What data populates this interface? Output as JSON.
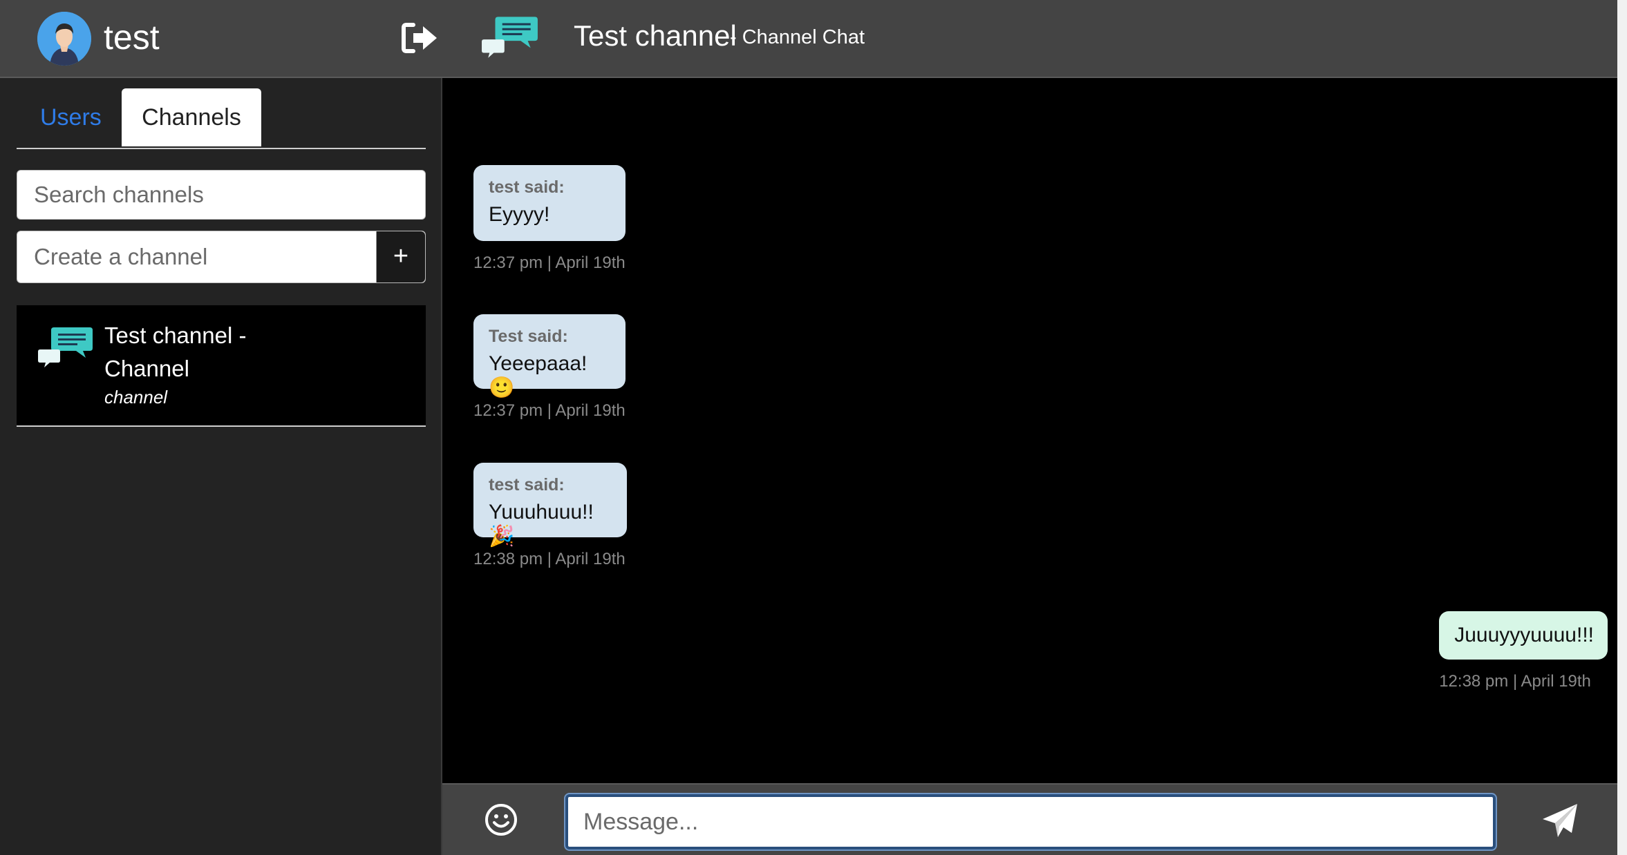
{
  "sidebar": {
    "user": {
      "name": "test"
    },
    "tabs": [
      {
        "label": "Users"
      },
      {
        "label": "Channels"
      }
    ],
    "search": {
      "placeholder": "Search channels"
    },
    "create": {
      "placeholder": "Create a channel",
      "button_label": "+"
    },
    "channels": [
      {
        "name": "Test channel - Channel",
        "type": "channel"
      }
    ]
  },
  "chat": {
    "title": "Test channel",
    "subtitle": "- Channel Chat",
    "messages": [
      {
        "sender": "test said:",
        "text": "Eyyyy!",
        "time": "12:37 pm | April 19th"
      },
      {
        "sender": "Test said:",
        "text": "Yeeepaaa! 🙂",
        "time": "12:37 pm | April 19th"
      },
      {
        "sender": "test said:",
        "text": "Yuuuhuuu!! 🎉",
        "time": "12:38 pm | April 19th"
      },
      {
        "text": "Juuuyyyuuuu!!!",
        "time": "12:38 pm | April 19th"
      }
    ]
  },
  "composer": {
    "placeholder": "Message..."
  },
  "colors": {
    "accent": "#2f7ce8",
    "icon_teal": "#3ec9c4",
    "incoming_bubble": "#d4e3ef",
    "outgoing_bubble": "#d7f6e6"
  }
}
